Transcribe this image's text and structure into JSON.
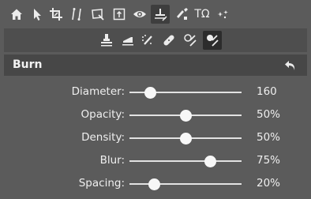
{
  "toolbar": {
    "tools": [
      {
        "name": "home-icon"
      },
      {
        "name": "pointer-icon"
      },
      {
        "name": "crop-icon"
      },
      {
        "name": "straighten-icon"
      },
      {
        "name": "perspective-icon"
      },
      {
        "name": "canvas-size-icon"
      },
      {
        "name": "eye-icon"
      },
      {
        "name": "burn-dodge-tool-icon",
        "active": true
      },
      {
        "name": "paint-icon"
      },
      {
        "name": "text-tool-icon"
      },
      {
        "name": "effects-icon"
      }
    ],
    "text_tool_glyph": "TΩ"
  },
  "subtoolbar": {
    "tools": [
      {
        "name": "stamp-icon"
      },
      {
        "name": "eraser-icon"
      },
      {
        "name": "spot-heal-icon"
      },
      {
        "name": "bandage-icon"
      },
      {
        "name": "dodge-icon"
      },
      {
        "name": "burn-icon",
        "active": true
      }
    ]
  },
  "panel": {
    "title": "Burn",
    "undo_icon": "undo-arrow-icon"
  },
  "sliders": [
    {
      "id": "diameter",
      "label": "Diameter:",
      "value": "160",
      "level": 0.19
    },
    {
      "id": "opacity",
      "label": "Opacity:",
      "value": "50%",
      "level": 0.5
    },
    {
      "id": "density",
      "label": "Density:",
      "value": "50%",
      "level": 0.5
    },
    {
      "id": "blur",
      "label": "Blur:",
      "value": "75%",
      "level": 0.72
    },
    {
      "id": "spacing",
      "label": "Spacing:",
      "value": "20%",
      "level": 0.22
    }
  ],
  "colors": {
    "background": "#5b5b5b",
    "subbar": "#4e4e4e",
    "header": "#474747",
    "active_tool": "#3e3e3e",
    "track": "#e2e2e2"
  }
}
